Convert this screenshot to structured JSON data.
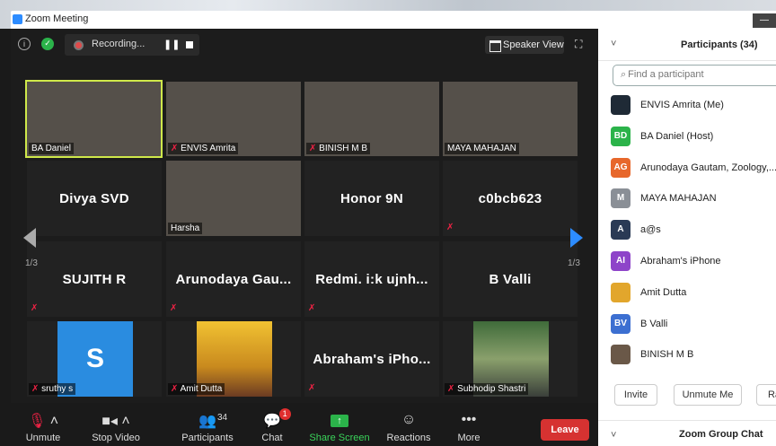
{
  "window": {
    "title": "Zoom Meeting",
    "minimize": "—"
  },
  "topbar": {
    "recording": "Recording...",
    "pause": "❚❚",
    "speaker_view": "Speaker View"
  },
  "tiles": [
    {
      "name": "BA Daniel",
      "label": "BA Daniel",
      "type": "photo"
    },
    {
      "name": "ENVIS Amrita",
      "label": "ENVIS Amrita",
      "type": "photo"
    },
    {
      "name": "BINISH M B",
      "label": "BINISH M B",
      "type": "photo"
    },
    {
      "name": "MAYA MAHAJAN",
      "label": "MAYA MAHAJAN",
      "type": "photo"
    },
    {
      "name": "Divya SVD",
      "label": "",
      "type": "text"
    },
    {
      "name": "Harsha",
      "label": "Harsha",
      "type": "photo"
    },
    {
      "name": "Honor 9N",
      "label": "",
      "type": "text"
    },
    {
      "name": "c0bcb623",
      "label": "",
      "type": "text"
    },
    {
      "name": "SUJITH R",
      "label": "",
      "type": "text"
    },
    {
      "name": "Arunodaya Gau...",
      "label": "",
      "type": "text"
    },
    {
      "name": "Redmi. i:k ujnh...",
      "label": "",
      "type": "text"
    },
    {
      "name": "B Valli",
      "label": "",
      "type": "text"
    },
    {
      "name": "S",
      "label": "sruthy s",
      "type": "avatar"
    },
    {
      "name": "Amit Dutta",
      "label": "Amit Dutta",
      "type": "avatarphoto"
    },
    {
      "name": "Abraham's iPho...",
      "label": "",
      "type": "text"
    },
    {
      "name": "Subhodip Shastri",
      "label": "Subhodip Shastri",
      "type": "avatarphoto"
    }
  ],
  "pager": {
    "left": "1/3",
    "right": "1/3"
  },
  "toolbar": {
    "unmute": "Unmute",
    "stop_video": "Stop Video",
    "participants": "Participants",
    "participants_count": "34",
    "chat": "Chat",
    "chat_badge": "1",
    "share_screen": "Share Screen",
    "reactions": "Reactions",
    "more": "More",
    "leave": "Leave"
  },
  "panel": {
    "title": "Participants (34)",
    "search_placeholder": "Find a participant",
    "participants": [
      {
        "initials": "",
        "name": "ENVIS Amrita (Me)",
        "color": "#1f2a36"
      },
      {
        "initials": "BD",
        "name": "BA Daniel (Host)",
        "color": "#2bb34a"
      },
      {
        "initials": "AG",
        "name": "Arunodaya Gautam, Zoology,...",
        "color": "#e7672b"
      },
      {
        "initials": "M",
        "name": "MAYA MAHAJAN",
        "color": "#8a8f96"
      },
      {
        "initials": "A",
        "name": "a@s",
        "color": "#2a3a55"
      },
      {
        "initials": "AI",
        "name": "Abraham's iPhone",
        "color": "#8e44c9"
      },
      {
        "initials": "",
        "name": "Amit Dutta",
        "color": "#e2a62c"
      },
      {
        "initials": "BV",
        "name": "B Valli",
        "color": "#3c6fd1"
      },
      {
        "initials": "",
        "name": "BINISH M B",
        "color": "#6a5848"
      }
    ],
    "invite": "Invite",
    "unmute_me": "Unmute Me",
    "raise": "Ra",
    "chat_title": "Zoom Group Chat"
  }
}
